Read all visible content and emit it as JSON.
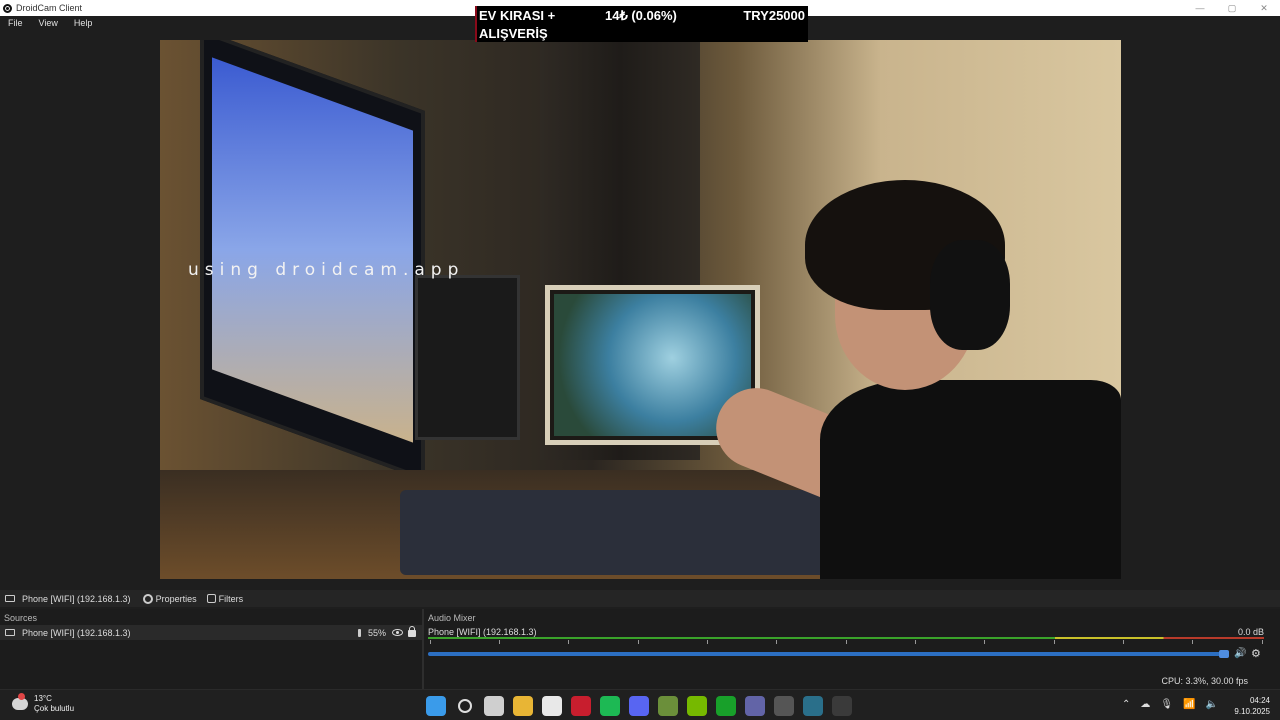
{
  "window": {
    "title": "DroidCam Client",
    "controls": [
      "—",
      "▢",
      "✕"
    ]
  },
  "menu": {
    "items": [
      "File",
      "View",
      "Help"
    ]
  },
  "ticker": {
    "line1": "EV KIRASI +",
    "line2": "ALIŞVERİŞ",
    "change": "14₺ (0.06%)",
    "amount": "TRY25000"
  },
  "preview": {
    "watermark": "using droidcam.app"
  },
  "source_bar": {
    "source_label": "Phone [WIFI] (192.168.1.3)",
    "properties_label": "Properties",
    "filters_label": "Filters"
  },
  "sources": {
    "title": "Sources",
    "items": [
      {
        "name": "Phone [WIFI] (192.168.1.3)",
        "volume": "55%"
      }
    ]
  },
  "audio_mixer": {
    "title": "Audio Mixer",
    "channel": {
      "name": "Phone [WIFI] (192.168.1.3)",
      "db": "0.0 dB"
    }
  },
  "status": {
    "text": "CPU: 3.3%, 30.00 fps"
  },
  "taskbar": {
    "weather": {
      "temp": "13°C",
      "condition": "Çok bulutlu"
    },
    "clock": {
      "time": "04:24",
      "date": "9.10.2025"
    },
    "app_icons": [
      {
        "name": "windows-start-icon",
        "color": "#3a9bea"
      },
      {
        "name": "search-icon",
        "color": "transparent"
      },
      {
        "name": "task-view-icon",
        "color": "#cfcfcf"
      },
      {
        "name": "file-explorer-icon",
        "color": "#e8b535"
      },
      {
        "name": "store-icon",
        "color": "#e8e8e8"
      },
      {
        "name": "opera-icon",
        "color": "#c81e2e"
      },
      {
        "name": "spotify-icon",
        "color": "#1db954"
      },
      {
        "name": "discord-icon",
        "color": "#5865f2"
      },
      {
        "name": "minecraft-icon",
        "color": "#6b8f3a"
      },
      {
        "name": "nvidia-icon",
        "color": "#76b900"
      },
      {
        "name": "xbox-icon",
        "color": "#18a02a"
      },
      {
        "name": "teams-icon",
        "color": "#6264a7"
      },
      {
        "name": "app-icon",
        "color": "#555555"
      },
      {
        "name": "riot-icon",
        "color": "#2a6f8a"
      },
      {
        "name": "tray-app-icon",
        "color": "#3a3a3a"
      }
    ]
  }
}
